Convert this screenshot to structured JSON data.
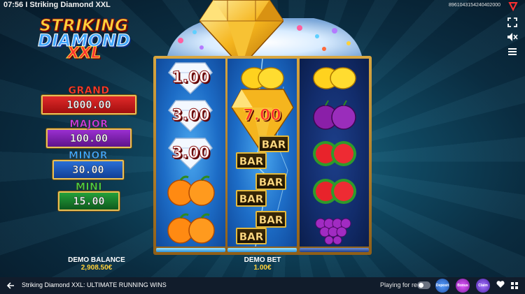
{
  "header": {
    "time": "07:56",
    "separator": "I",
    "title": "Striking Diamond XXL",
    "session_id": "8961043154240402000"
  },
  "logo": {
    "line1": "STRIKING",
    "line2": "DIAMOND",
    "line3": "XXL"
  },
  "jackpots": [
    {
      "label": "GRAND",
      "value": "1000.00",
      "label_color": "#ff3b2f",
      "box_color": "#c81414"
    },
    {
      "label": "MAJOR",
      "value": "100.00",
      "label_color": "#c640e8",
      "box_color": "#7d1fa8"
    },
    {
      "label": "MINOR",
      "value": "30.00",
      "label_color": "#38a8ff",
      "box_color": "#1557b8"
    },
    {
      "label": "MINI",
      "value": "15.00",
      "label_color": "#46d04a",
      "box_color": "#177a2a"
    }
  ],
  "reels": {
    "reel1": {
      "values": [
        "1.00",
        "3.00",
        "3.00"
      ],
      "fruits": [
        "orange",
        "orange"
      ]
    },
    "reel2": {
      "big_value": "7.00",
      "bar_symbol": "BAR"
    },
    "reel3": {
      "symbols": [
        "lemon",
        "plum",
        "watermelon",
        "watermelon",
        "grapes"
      ]
    }
  },
  "balance": {
    "label": "DEMO BALANCE",
    "value": "2,908.50€"
  },
  "bet": {
    "label": "DEMO BET",
    "value": "1.00€"
  },
  "footer": {
    "back_icon": "arrow-left-icon",
    "game_title": "Striking Diamond XXL: ULTIMATE RUNNING WINS",
    "playing_for_real": "Playing for real",
    "promos": [
      {
        "name": "promo-deposit",
        "label": "Deposit",
        "color": "#3a7bd5"
      },
      {
        "name": "promo-bonus",
        "label": "Bonus",
        "color": "#b42bd6"
      },
      {
        "name": "promo-claim",
        "label": "Claim",
        "color": "#7a3fd8"
      }
    ]
  },
  "colors": {
    "accent_gold": "#ffd23a",
    "reel_blue": "#1d6dc7",
    "reel_dark": "#122c6b",
    "bottom_bar": "#111c2b"
  }
}
